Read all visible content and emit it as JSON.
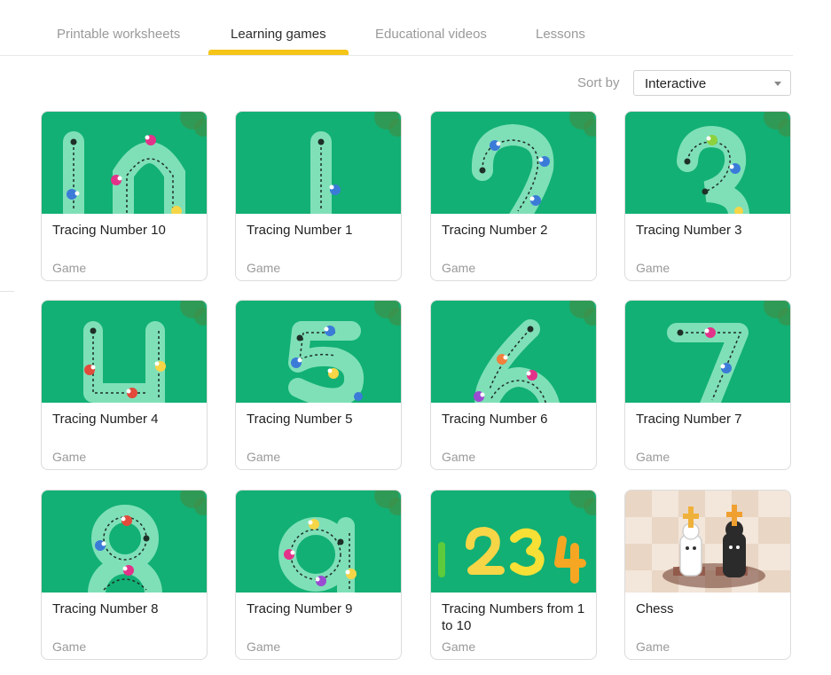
{
  "tabs": [
    {
      "label": "Printable worksheets",
      "active": false
    },
    {
      "label": "Learning games",
      "active": true
    },
    {
      "label": "Educational videos",
      "active": false
    },
    {
      "label": "Lessons",
      "active": false
    }
  ],
  "sort": {
    "label": "Sort by",
    "value": "Interactive"
  },
  "colors": {
    "accent": "#f5c518",
    "thumb_bg": "#12b074",
    "track": "#7fe0b8"
  },
  "cards": [
    {
      "title": "Tracing Number 10",
      "type": "Game",
      "thumb": "number-10-icon"
    },
    {
      "title": "Tracing Number 1",
      "type": "Game",
      "thumb": "number-1-icon"
    },
    {
      "title": "Tracing Number 2",
      "type": "Game",
      "thumb": "number-2-icon"
    },
    {
      "title": "Tracing Number 3",
      "type": "Game",
      "thumb": "number-3-icon"
    },
    {
      "title": "Tracing Number 4",
      "type": "Game",
      "thumb": "number-4-icon"
    },
    {
      "title": "Tracing Number 5",
      "type": "Game",
      "thumb": "number-5-icon"
    },
    {
      "title": "Tracing Number 6",
      "type": "Game",
      "thumb": "number-6-icon"
    },
    {
      "title": "Tracing Number 7",
      "type": "Game",
      "thumb": "number-7-icon"
    },
    {
      "title": "Tracing Number 8",
      "type": "Game",
      "thumb": "number-8-icon"
    },
    {
      "title": "Tracing Number 9",
      "type": "Game",
      "thumb": "number-9-icon"
    },
    {
      "title": "Tracing Numbers from 1 to 10",
      "type": "Game",
      "thumb": "colorful-numbers-icon"
    },
    {
      "title": "Chess",
      "type": "Game",
      "thumb": "chess-pieces-icon"
    }
  ]
}
